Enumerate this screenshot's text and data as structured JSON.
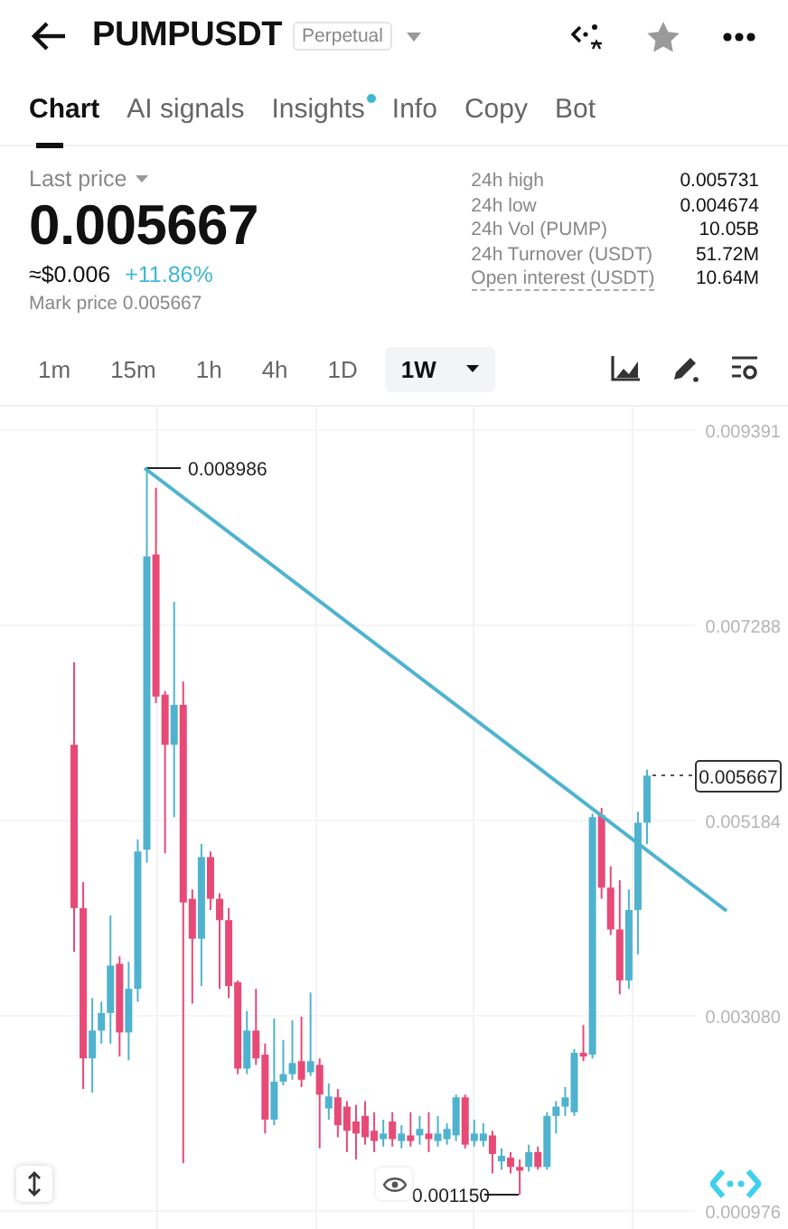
{
  "header": {
    "title": "PUMPUSDT",
    "badge": "Perpetual"
  },
  "tabs": [
    {
      "label": "Chart",
      "selected": true,
      "dot": false
    },
    {
      "label": "AI signals",
      "selected": false,
      "dot": false
    },
    {
      "label": "Insights",
      "selected": false,
      "dot": true
    },
    {
      "label": "Info",
      "selected": false,
      "dot": false
    },
    {
      "label": "Copy",
      "selected": false,
      "dot": false
    },
    {
      "label": "Bot",
      "selected": false,
      "dot": false
    }
  ],
  "price": {
    "label": "Last price",
    "value": "0.005667",
    "approx": "≈$0.006",
    "change": "+11.86%",
    "mark": "Mark price 0.005667"
  },
  "stats": [
    {
      "label": "24h high",
      "value": "0.005731",
      "underlined": false
    },
    {
      "label": "24h low",
      "value": "0.004674",
      "underlined": false
    },
    {
      "label": "24h Vol (PUMP)",
      "value": "10.05B",
      "underlined": false
    },
    {
      "label": "24h Turnover (USDT)",
      "value": "51.72M",
      "underlined": false
    },
    {
      "label": "Open interest (USDT)",
      "value": "10.64M",
      "underlined": true
    }
  ],
  "intervals": [
    {
      "label": "1m",
      "selected": false,
      "dropdown": false
    },
    {
      "label": "15m",
      "selected": false,
      "dropdown": false
    },
    {
      "label": "1h",
      "selected": false,
      "dropdown": false
    },
    {
      "label": "4h",
      "selected": false,
      "dropdown": false
    },
    {
      "label": "1D",
      "selected": false,
      "dropdown": false
    },
    {
      "label": "1W",
      "selected": true,
      "dropdown": true
    }
  ],
  "chart": {
    "high_label": "0.008986",
    "low_label": "0.001150",
    "last_tag": "0.005667",
    "chart_data": {
      "type": "candlestick",
      "grid": true,
      "ylim": [
        0.000976,
        0.009391
      ],
      "yticks": [
        {
          "value": 0.009391,
          "label": "0.009391"
        },
        {
          "value": 0.007288,
          "label": "0.007288"
        },
        {
          "value": 0.005184,
          "label": "0.005184"
        },
        {
          "value": 0.00308,
          "label": "0.003080"
        },
        {
          "value": 0.000976,
          "label": "0.000976"
        }
      ],
      "ohlc": [
        [
          0.006,
          0.00689,
          0.00377,
          0.00424
        ],
        [
          0.00424,
          0.00452,
          0.00229,
          0.00262
        ],
        [
          0.00262,
          0.00327,
          0.00225,
          0.00292
        ],
        [
          0.00292,
          0.00323,
          0.00278,
          0.00311
        ],
        [
          0.00311,
          0.00416,
          0.00278,
          0.00362
        ],
        [
          0.00364,
          0.00372,
          0.00264,
          0.0029
        ],
        [
          0.0029,
          0.00366,
          0.0026,
          0.00337
        ],
        [
          0.00337,
          0.00498,
          0.00323,
          0.00485
        ],
        [
          0.00487,
          0.008986,
          0.00473,
          0.00803
        ],
        [
          0.00805,
          0.00877,
          0.00645,
          0.00652
        ],
        [
          0.00654,
          0.00658,
          0.00483,
          0.006
        ],
        [
          0.006,
          0.00754,
          0.00522,
          0.00643
        ],
        [
          0.00643,
          0.00668,
          0.00149,
          0.0043
        ],
        [
          0.00434,
          0.00444,
          0.00321,
          0.00391
        ],
        [
          0.00391,
          0.00493,
          0.0034,
          0.00479
        ],
        [
          0.00479,
          0.00485,
          0.00422,
          0.00434
        ],
        [
          0.00434,
          0.0044,
          0.00337,
          0.00411
        ],
        [
          0.00411,
          0.00424,
          0.00327,
          0.0034
        ],
        [
          0.00344,
          0.00346,
          0.00245,
          0.00251
        ],
        [
          0.00251,
          0.00313,
          0.00245,
          0.00292
        ],
        [
          0.00292,
          0.00337,
          0.00255,
          0.00262
        ],
        [
          0.00266,
          0.00278,
          0.00181,
          0.00196
        ],
        [
          0.00196,
          0.00305,
          0.0019,
          0.00237
        ],
        [
          0.00237,
          0.00282,
          0.00233,
          0.00245
        ],
        [
          0.00245,
          0.00303,
          0.00239,
          0.00257
        ],
        [
          0.00259,
          0.00307,
          0.00231,
          0.00239
        ],
        [
          0.00247,
          0.00333,
          0.00243,
          0.00259
        ],
        [
          0.00255,
          0.00262,
          0.00165,
          0.00223
        ],
        [
          0.00208,
          0.00235,
          0.00196,
          0.00221
        ],
        [
          0.0022,
          0.00229,
          0.00177,
          0.0019
        ],
        [
          0.0021,
          0.00216,
          0.00161,
          0.00184
        ],
        [
          0.00194,
          0.00212,
          0.00153,
          0.00181
        ],
        [
          0.002,
          0.00216,
          0.00169,
          0.00177
        ],
        [
          0.00184,
          0.00204,
          0.00161,
          0.00173
        ],
        [
          0.00175,
          0.00196,
          0.00167,
          0.00181
        ],
        [
          0.00194,
          0.00204,
          0.00167,
          0.00175
        ],
        [
          0.00173,
          0.0019,
          0.00165,
          0.00181
        ],
        [
          0.00179,
          0.00204,
          0.00167,
          0.00173
        ],
        [
          0.00179,
          0.002,
          0.00169,
          0.00186
        ],
        [
          0.00181,
          0.00204,
          0.00161,
          0.00175
        ],
        [
          0.00173,
          0.002,
          0.00167,
          0.00181
        ],
        [
          0.00175,
          0.00192,
          0.00169,
          0.00186
        ],
        [
          0.00179,
          0.00223,
          0.00173,
          0.0022
        ],
        [
          0.0022,
          0.00223,
          0.00165,
          0.00169
        ],
        [
          0.00173,
          0.00196,
          0.00167,
          0.00181
        ],
        [
          0.00173,
          0.00192,
          0.00167,
          0.00181
        ],
        [
          0.00179,
          0.00184,
          0.00138,
          0.00159
        ],
        [
          0.00151,
          0.00165,
          0.00142,
          0.00157
        ],
        [
          0.00155,
          0.00161,
          0.00138,
          0.00145
        ],
        [
          0.00145,
          0.00153,
          0.00115,
          0.00142
        ],
        [
          0.00145,
          0.00169,
          0.0014,
          0.00161
        ],
        [
          0.00161,
          0.00167,
          0.00142,
          0.00145
        ],
        [
          0.00145,
          0.00204,
          0.00142,
          0.002
        ],
        [
          0.002,
          0.00216,
          0.00181,
          0.0021
        ],
        [
          0.0021,
          0.00231,
          0.002,
          0.0022
        ],
        [
          0.00204,
          0.00272,
          0.002,
          0.00268
        ],
        [
          0.00268,
          0.00298,
          0.00259,
          0.00264
        ],
        [
          0.00266,
          0.00526,
          0.00262,
          0.00522
        ],
        [
          0.00524,
          0.00532,
          0.00434,
          0.00446
        ],
        [
          0.00446,
          0.00469,
          0.00395,
          0.00401
        ],
        [
          0.00401,
          0.00454,
          0.00331,
          0.00346
        ],
        [
          0.00346,
          0.00444,
          0.00337,
          0.00422
        ],
        [
          0.00422,
          0.00528,
          0.00374,
          0.00516
        ],
        [
          0.00516,
          0.005731,
          0.00493,
          0.005667
        ]
      ]
    }
  }
}
